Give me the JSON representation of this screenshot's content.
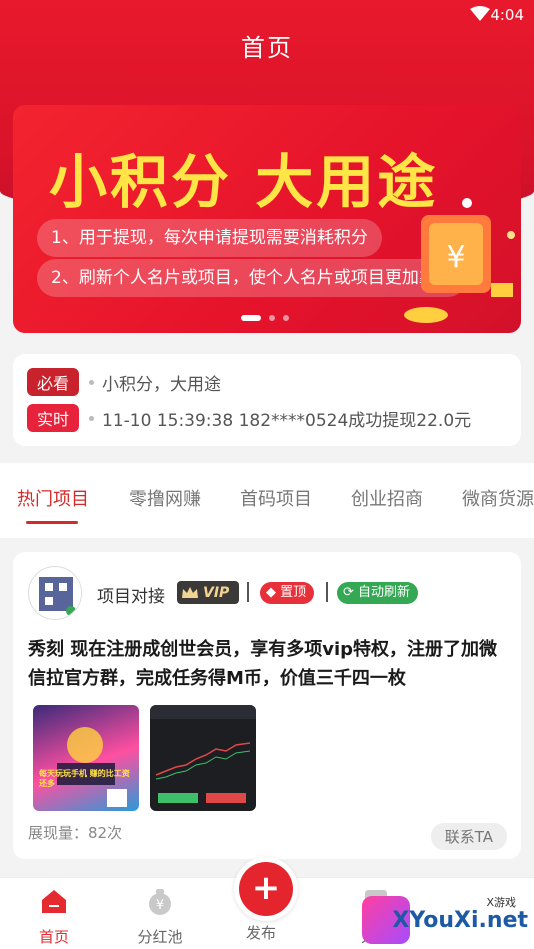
{
  "status_bar": {
    "time": "4:04"
  },
  "page": {
    "title": "首页"
  },
  "banner": {
    "headline": "小积分 大用途",
    "lines": [
      "1、用于提现，每次申请提现需要消耗积分",
      "2、刷新个人名片或项目，使个人名片或项目更加靠前"
    ]
  },
  "notices": [
    {
      "tag": "必看",
      "text": "小积分，大用途"
    },
    {
      "tag": "实时",
      "text": "11-10 15:39:38 182****0524成功提现22.0元"
    }
  ],
  "category_tabs": [
    "热门项目",
    "零撸网赚",
    "首码项目",
    "创业招商",
    "微商货源"
  ],
  "post": {
    "source": "项目对接",
    "vip_label": "VIP",
    "top_label": "置顶",
    "refresh_label": "自动刷新",
    "title": "秀刻 现在注册成创世会员，享有多项vip特权，注册了加微信拉官方群，完成任务得M币，价值三千四一枚",
    "thumb_caption": "每天玩玩手机 赚的比工资还多",
    "views": "展现量：82次",
    "contact": "联系TA"
  },
  "tabbar": {
    "items": [
      "首页",
      "分红池",
      "发布",
      "人脉"
    ]
  },
  "watermark": {
    "small": "X游戏",
    "big": "XYouXi.net"
  },
  "colors": {
    "primary": "#e5252d",
    "banner_text": "#ffe545",
    "vip_gold": "#f2d594"
  }
}
